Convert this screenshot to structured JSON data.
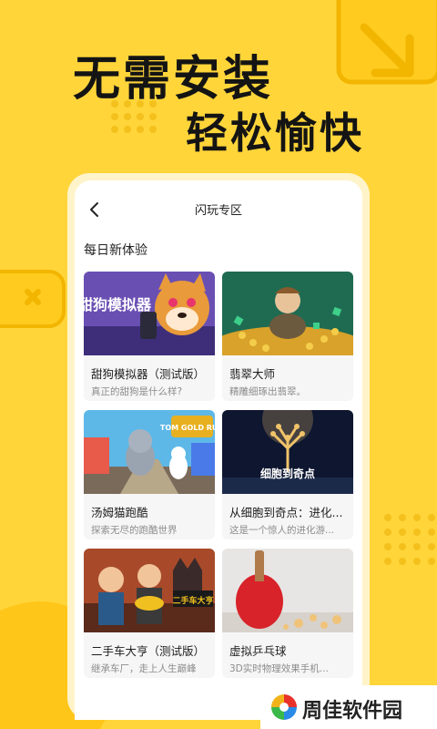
{
  "hero": {
    "line1": "无需安装",
    "line2": "轻松愉快"
  },
  "nav": {
    "title": "闪玩专区"
  },
  "section": {
    "title": "每日新体验"
  },
  "games": [
    {
      "name": "甜狗模拟器（测试版）",
      "desc": "真正的甜狗是什么样?",
      "thumb_text": "甜狗模拟器"
    },
    {
      "name": "翡翠大师",
      "desc": "精雕细琢出翡翠。"
    },
    {
      "name": "汤姆猫跑酷",
      "desc": "探索无尽的跑酷世界",
      "thumb_text": "TOM GOLD RUN"
    },
    {
      "name": "从细胞到奇点：进化...",
      "desc": "这是一个惊人的进化游...",
      "thumb_text": "细胞到奇点"
    },
    {
      "name": "二手车大亨（测试版）",
      "desc": "继承车厂，走上人生巅峰",
      "thumb_text": "二手车大亨"
    },
    {
      "name": "虚拟乒乓球",
      "desc": "3D实时物理效果手机..."
    }
  ],
  "watermark": {
    "text": "周佳软件园"
  },
  "colors": {
    "background": "#FFD53A",
    "card_bg": "#F6F6F6",
    "text_primary": "#1E1E1E",
    "text_secondary": "#8C8C8C"
  }
}
